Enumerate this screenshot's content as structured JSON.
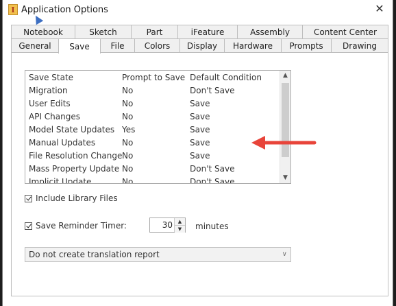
{
  "window": {
    "title": "Application Options",
    "app_icon_letter": "I",
    "close_glyph": "✕"
  },
  "tabs": {
    "row1": [
      "Notebook",
      "Sketch",
      "Part",
      "iFeature",
      "Assembly",
      "Content Center"
    ],
    "row2": [
      "General",
      "Save",
      "File",
      "Colors",
      "Display",
      "Hardware",
      "Prompts",
      "Drawing"
    ],
    "active": "Save"
  },
  "list": {
    "headers": [
      "Save State",
      "Prompt to Save",
      "Default Condition"
    ],
    "rows": [
      [
        "Migration",
        "No",
        "Don't Save"
      ],
      [
        "User Edits",
        "No",
        "Save"
      ],
      [
        "API Changes",
        "No",
        "Save"
      ],
      [
        "Model State Updates",
        "Yes",
        "Save"
      ],
      [
        "Manual Updates",
        "No",
        "Save"
      ],
      [
        "File Resolution Change",
        "No",
        "Save"
      ],
      [
        "Mass Property Update",
        "No",
        "Don't Save"
      ],
      [
        "Implicit Update",
        "No",
        "Don't Save"
      ]
    ]
  },
  "options": {
    "include_library_files": "Include Library Files",
    "save_reminder_timer": "Save Reminder Timer:",
    "timer_value": "30",
    "timer_unit": "minutes"
  },
  "translation": {
    "selected": "Do not create translation report"
  },
  "colors": {
    "annotation_arrow": "#e8443a"
  },
  "icons": {
    "app": "inventor-app-icon",
    "close": "close-icon",
    "check": "checkmark-icon",
    "dropdown": "chevron-down-icon",
    "annotation": "red-arrow-annotation"
  }
}
